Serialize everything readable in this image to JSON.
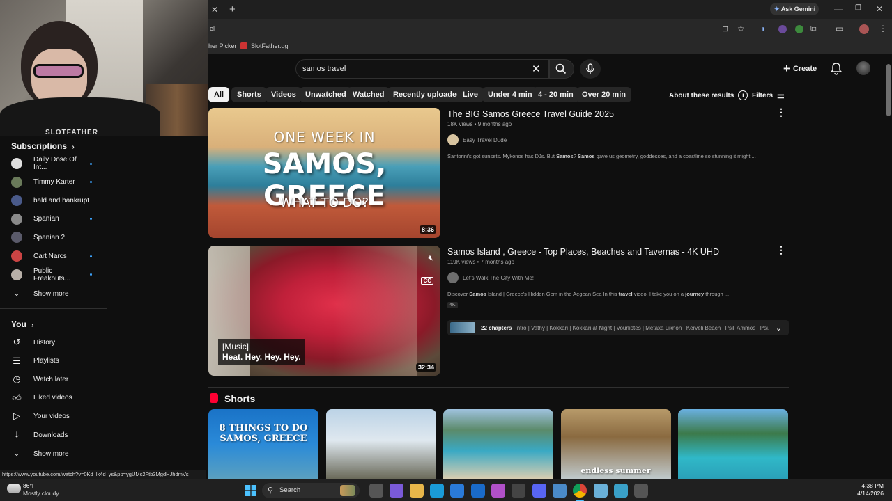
{
  "webcam": {
    "shirt_text": "SLOTFATHER"
  },
  "browser": {
    "address_partial": "el",
    "ask_gemini": "Ask Gemini",
    "bookmarks": [
      "her Picker",
      "SlotFather.gg"
    ],
    "status_url": "https://www.youtube.com/watch?v=0Kd_lk4d_ys&pp=ygUMc2Ftb3MgdHJhdmVs"
  },
  "header": {
    "search_value": "samos travel",
    "create_label": "Create"
  },
  "filters": {
    "chips": [
      "All",
      "Shorts",
      "Videos",
      "Unwatched",
      "Watched",
      "Recently uploaded",
      "Live",
      "Under 4 min",
      "4 - 20 min",
      "Over 20 min"
    ],
    "about": "About these results",
    "filters_label": "Filters"
  },
  "sidebar": {
    "subscriptions_label": "Subscriptions",
    "subscriptions": [
      {
        "name": "Daily Dose Of Int...",
        "new": true
      },
      {
        "name": "Timmy Karter",
        "new": true
      },
      {
        "name": "bald and bankrupt",
        "new": false
      },
      {
        "name": "Spanian",
        "new": true
      },
      {
        "name": "Spanian 2",
        "new": false
      },
      {
        "name": "Cart Narcs",
        "new": true
      },
      {
        "name": "Public Freakouts...",
        "new": true
      }
    ],
    "show_more_1": "Show more",
    "you_label": "You",
    "you_items": [
      "History",
      "Playlists",
      "Watch later",
      "Liked videos",
      "Your videos",
      "Downloads"
    ],
    "show_more_2": "Show more"
  },
  "results": [
    {
      "title": "The BIG Samos Greece Travel Guide 2025",
      "meta": "18K views • 9 months ago",
      "channel": "Easy Travel Dude",
      "description_parts": [
        "Santorini's got sunsets. Mykonos has DJs. But ",
        "Samos",
        "? ",
        "Samos",
        " gave us geometry, goddesses, and a coastline so stunning it might ..."
      ],
      "duration": "8:36",
      "thumb_line1": "ONE WEEK IN",
      "thumb_line2": "SAMOS, GREECE",
      "thumb_line3": "WHAT TO DO?"
    },
    {
      "title": "Samos Island , Greece - Top Places, Beaches and Tavernas - 4K UHD",
      "meta": "119K views • 7 months ago",
      "channel": "Let's Walk The City With Me!",
      "description_parts": [
        "Discover ",
        "Samos",
        " Island | Greece's Hidden Gem in the Aegean Sea In this ",
        "travel",
        " video, I take you on a ",
        "journey",
        " through ..."
      ],
      "badge": "4K",
      "chapters_count": "22 chapters",
      "chapters": "Intro | Vathy | Kokkari | Kokkari at Night | Vourliotes | Metaxa Liknon | Kerveli Beach | Psili Ammos | Psi...",
      "duration": "32:34",
      "caption_1": "[Music]",
      "caption_2": "Heat. Hey. Hey. Hey.",
      "cc": "CC"
    }
  ],
  "shorts": {
    "label": "Shorts",
    "items": [
      {
        "overlay": "8 THINGS TO DO\nSAMOS, GREECE"
      },
      {
        "overlay": ""
      },
      {
        "overlay": ""
      },
      {
        "overlay": "endless summer"
      },
      {
        "overlay": ""
      }
    ]
  },
  "taskbar": {
    "weather_temp": "86°F",
    "weather_desc": "Mostly cloudy",
    "search_label": "Search",
    "time": "4:38 PM",
    "date": "4/14/2026"
  },
  "colors": {
    "accent": "#3ea6ff",
    "shorts_red": "#ff0033"
  }
}
